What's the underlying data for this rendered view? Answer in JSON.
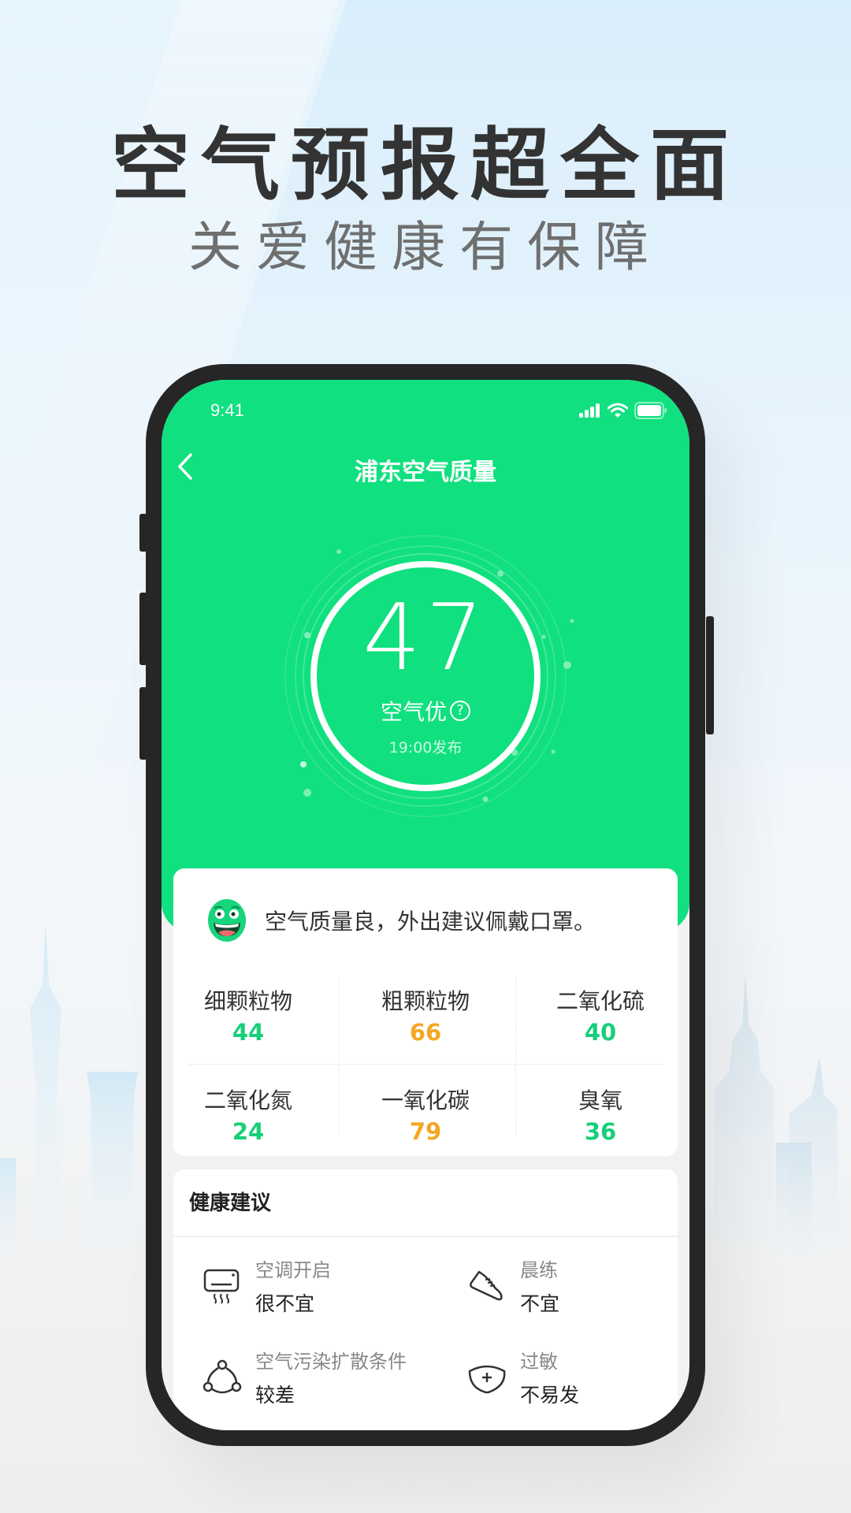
{
  "promo": {
    "headline": "空气预报超全面",
    "subline": "关爱健康有保障"
  },
  "status_bar": {
    "time": "9:41",
    "icons": [
      "signal-icon",
      "wifi-icon",
      "battery-icon"
    ]
  },
  "nav": {
    "back_icon": "chevron-left-icon",
    "title": "浦东空气质量"
  },
  "aqi": {
    "value": "47",
    "level": "空气优",
    "help_glyph": "?",
    "published": "19:00发布"
  },
  "summary": {
    "mascot": "smiley-face-icon",
    "tip": "空气质量良，外出建议佩戴口罩。"
  },
  "pollutants": [
    {
      "name": "细颗粒物",
      "value": "44",
      "status": "good"
    },
    {
      "name": "粗颗粒物",
      "value": "66",
      "status": "moderate"
    },
    {
      "name": "二氧化硫",
      "value": "40",
      "status": "good"
    },
    {
      "name": "二氧化氮",
      "value": "24",
      "status": "good"
    },
    {
      "name": "一氧化碳",
      "value": "79",
      "status": "moderate"
    },
    {
      "name": "臭氧",
      "value": "36",
      "status": "good"
    }
  ],
  "health": {
    "title": "健康建议",
    "items": [
      {
        "icon": "air-conditioner-icon",
        "label": "空调开启",
        "value": "很不宜"
      },
      {
        "icon": "sneaker-icon",
        "label": "晨练",
        "value": "不宜"
      },
      {
        "icon": "diffusion-icon",
        "label": "空气污染扩散条件",
        "value": "较差"
      },
      {
        "icon": "allergy-shield-icon",
        "label": "过敏",
        "value": "不易发"
      }
    ]
  },
  "colors": {
    "brand_green": "#10e07f",
    "good": "#17cf7a",
    "moderate": "#f5a623",
    "phone_frame": "#262626",
    "headline": "#333333"
  }
}
